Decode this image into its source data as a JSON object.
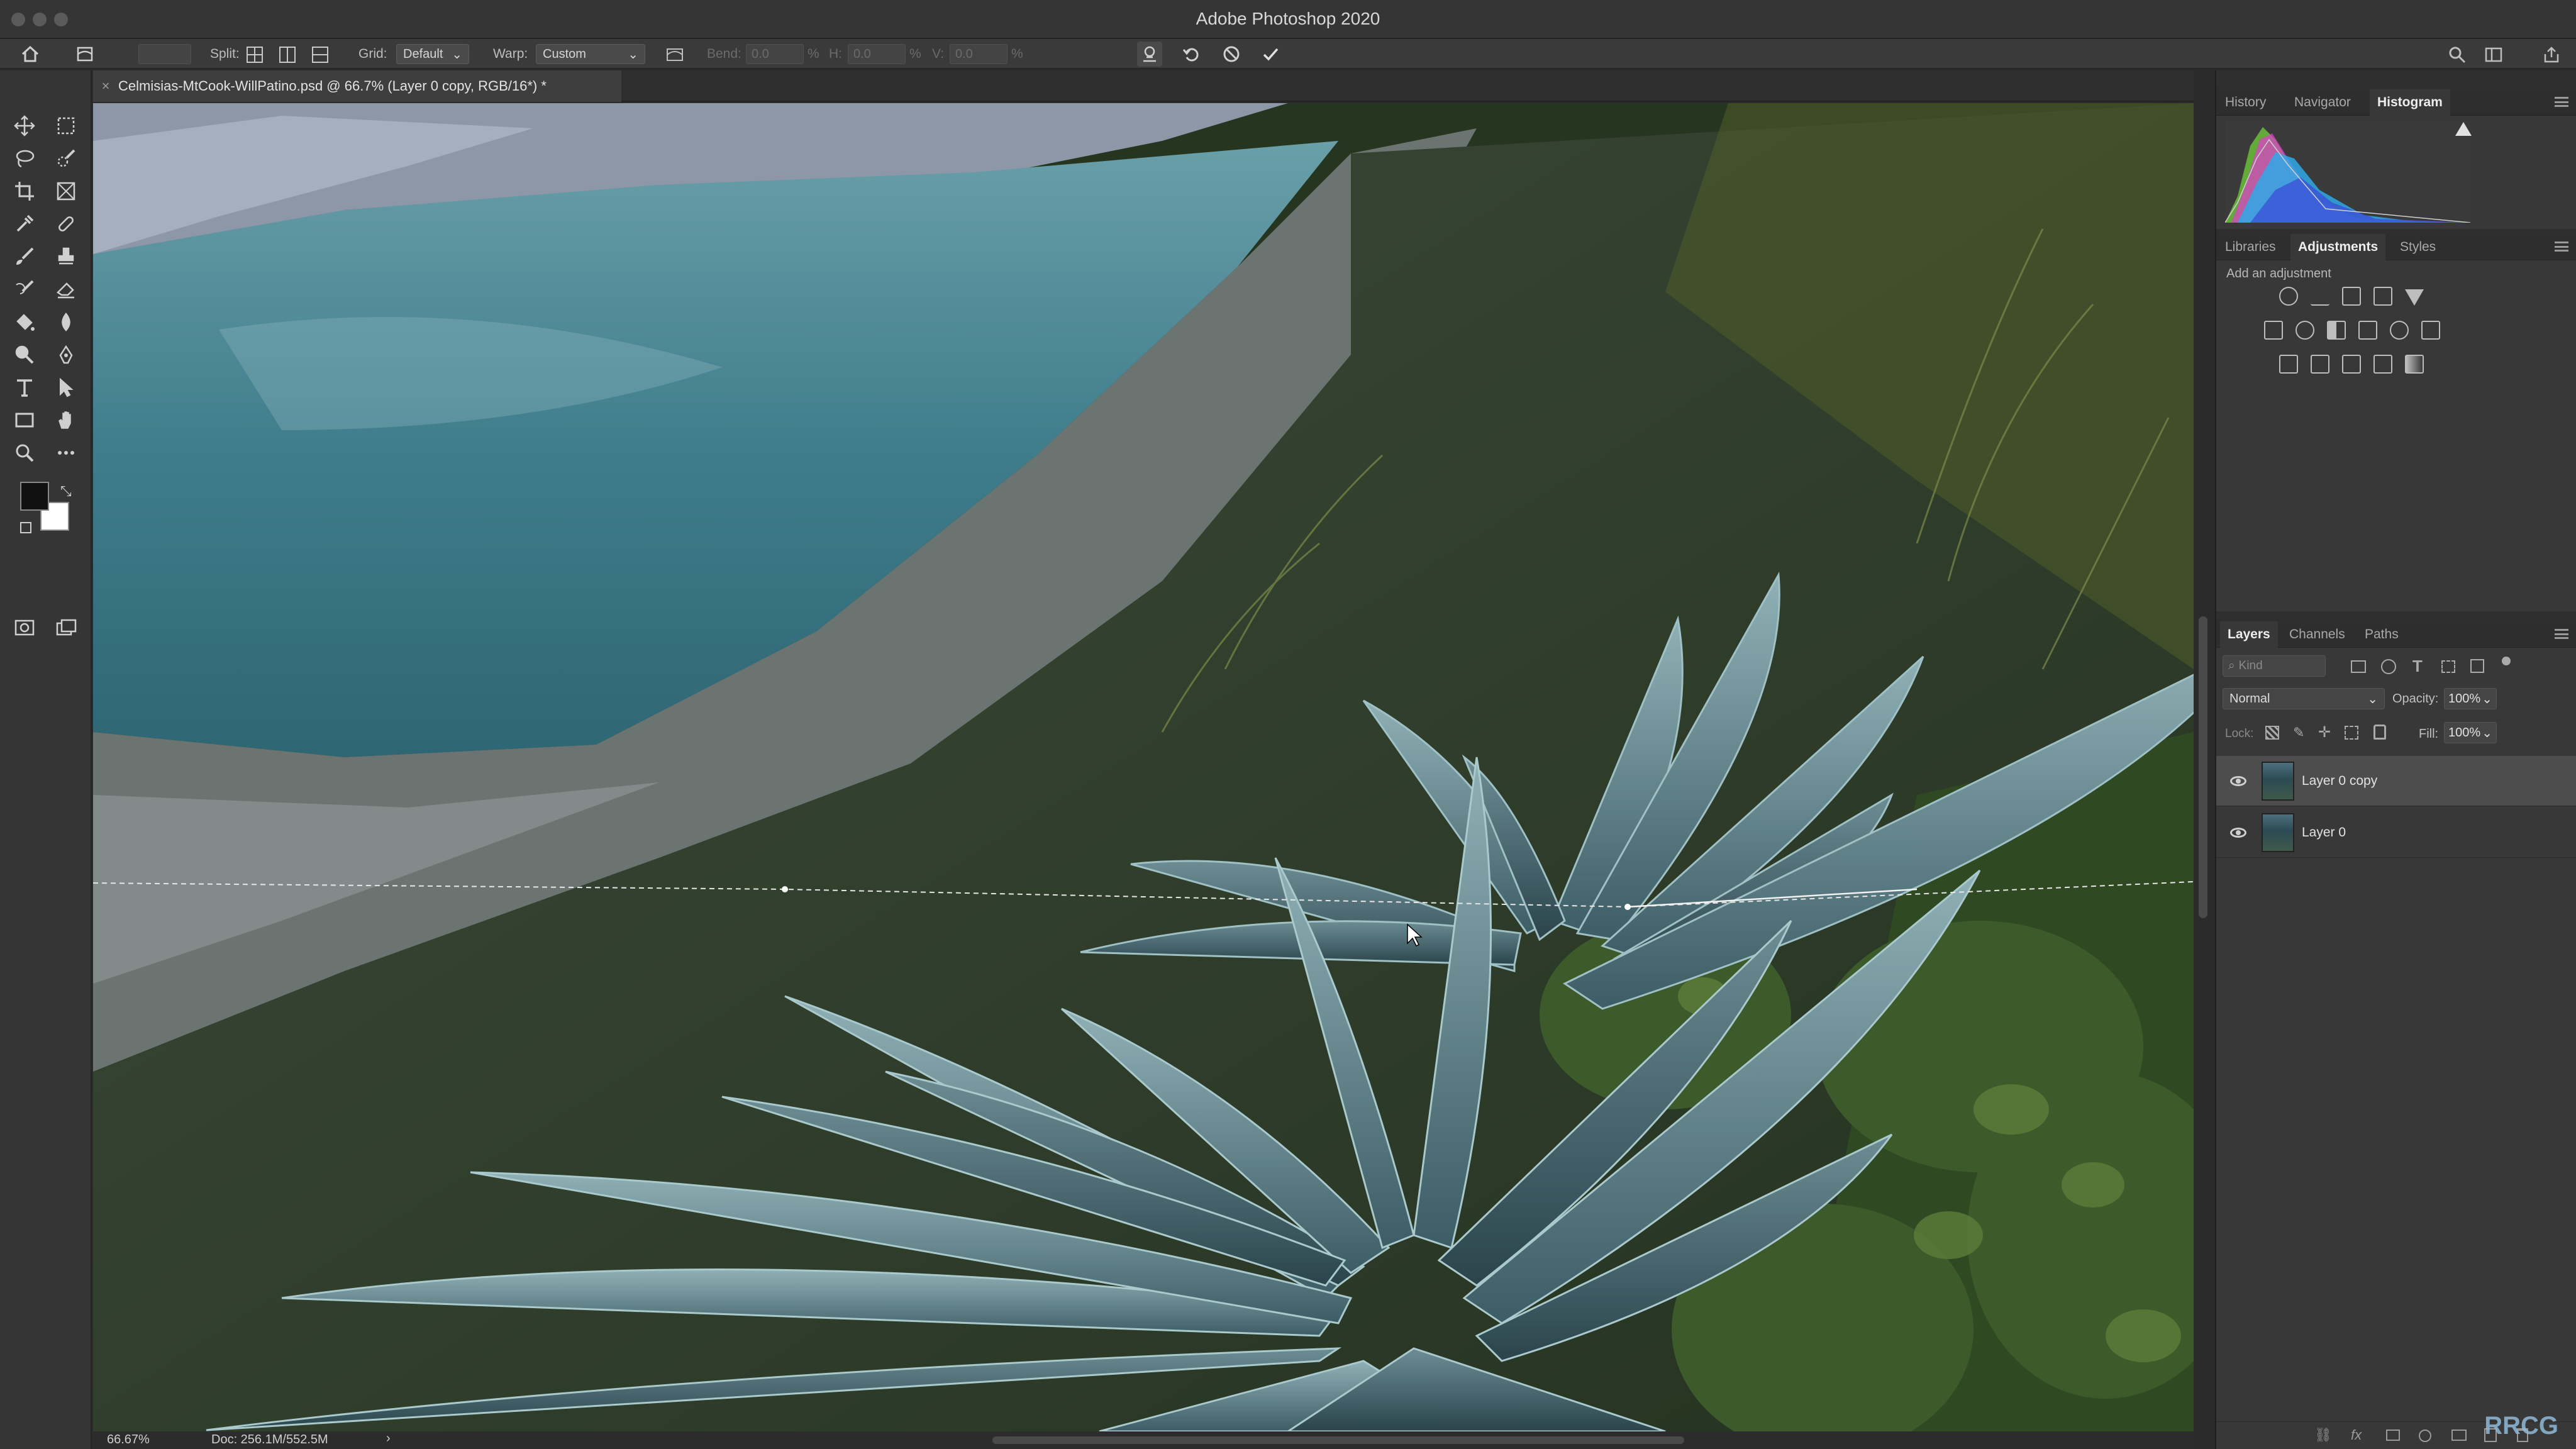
{
  "app": {
    "title": "Adobe Photoshop 2020"
  },
  "options_bar": {
    "split_label": "Split:",
    "grid_label": "Grid:",
    "grid_value": "Default",
    "warp_label": "Warp:",
    "warp_value": "Custom",
    "bend_label": "Bend:",
    "bend_value": "0.0",
    "bend_unit": "%",
    "h_label": "H:",
    "h_value": "0.0",
    "h_unit": "%",
    "v_label": "V:",
    "v_value": "0.0",
    "v_unit": "%"
  },
  "document": {
    "tab_title": "Celmisias-MtCook-WillPatino.psd @ 66.7% (Layer 0 copy, RGB/16*) *",
    "close_glyph": "×"
  },
  "status": {
    "zoom": "66.67%",
    "doc_size": "Doc: 256.1M/552.5M",
    "arrow": "›"
  },
  "panels": {
    "top_tabs": [
      "History",
      "Navigator",
      "Histogram"
    ],
    "top_active": "Histogram",
    "mid_tabs": [
      "Libraries",
      "Adjustments",
      "Styles"
    ],
    "mid_active": "Adjustments",
    "adjustments_hint": "Add an adjustment",
    "layer_tabs": [
      "Layers",
      "Channels",
      "Paths"
    ],
    "layer_active": "Layers",
    "kind_placeholder": "Kind",
    "blend_mode": "Normal",
    "opacity_label": "Opacity:",
    "opacity_value": "100%",
    "lock_label": "Lock:",
    "fill_label": "Fill:",
    "fill_value": "100%",
    "layers": [
      {
        "name": "Layer 0 copy",
        "selected": true
      },
      {
        "name": "Layer 0",
        "selected": false
      }
    ]
  },
  "watermark": "RRCG",
  "colors": {
    "foreground": "#111111",
    "background": "#ffffff",
    "accent": "#3d3d3d"
  }
}
